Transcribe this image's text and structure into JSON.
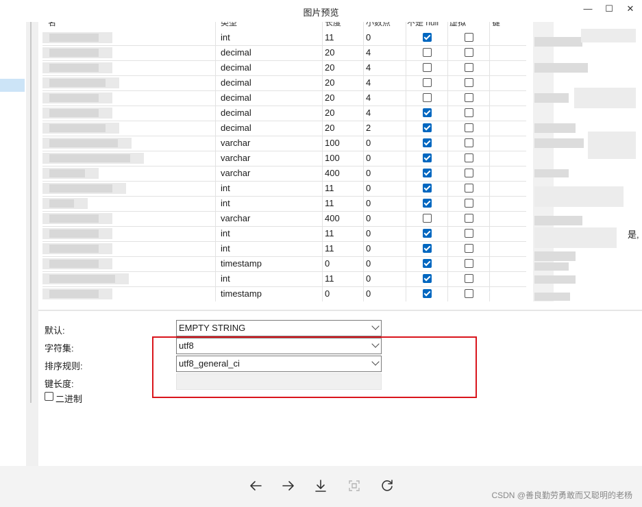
{
  "window": {
    "title": "图片预览",
    "controls": {
      "minimize": "—",
      "maximize": "☐",
      "close": "✕"
    }
  },
  "grid": {
    "columns": [
      "名",
      "类型",
      "长度",
      "小数点",
      "不是 null",
      "虚拟",
      "键"
    ],
    "rows": [
      {
        "type": "int",
        "length": "11",
        "decimals": "0",
        "not_null": true,
        "virtual": false
      },
      {
        "type": "decimal",
        "length": "20",
        "decimals": "4",
        "not_null": false,
        "virtual": false
      },
      {
        "type": "decimal",
        "length": "20",
        "decimals": "4",
        "not_null": false,
        "virtual": false
      },
      {
        "type": "decimal",
        "length": "20",
        "decimals": "4",
        "not_null": false,
        "virtual": false
      },
      {
        "type": "decimal",
        "length": "20",
        "decimals": "4",
        "not_null": false,
        "virtual": false
      },
      {
        "type": "decimal",
        "length": "20",
        "decimals": "4",
        "not_null": true,
        "virtual": false
      },
      {
        "type": "decimal",
        "length": "20",
        "decimals": "2",
        "not_null": true,
        "virtual": false
      },
      {
        "type": "varchar",
        "length": "100",
        "decimals": "0",
        "not_null": true,
        "virtual": false
      },
      {
        "type": "varchar",
        "length": "100",
        "decimals": "0",
        "not_null": true,
        "virtual": false
      },
      {
        "type": "varchar",
        "length": "400",
        "decimals": "0",
        "not_null": true,
        "virtual": false
      },
      {
        "type": "int",
        "length": "11",
        "decimals": "0",
        "not_null": true,
        "virtual": false
      },
      {
        "type": "int",
        "length": "11",
        "decimals": "0",
        "not_null": true,
        "virtual": false
      },
      {
        "type": "varchar",
        "length": "400",
        "decimals": "0",
        "not_null": false,
        "virtual": false
      },
      {
        "type": "int",
        "length": "11",
        "decimals": "0",
        "not_null": true,
        "virtual": false
      },
      {
        "type": "int",
        "length": "11",
        "decimals": "0",
        "not_null": true,
        "virtual": false
      },
      {
        "type": "timestamp",
        "length": "0",
        "decimals": "0",
        "not_null": true,
        "virtual": false
      },
      {
        "type": "int",
        "length": "11",
        "decimals": "0",
        "not_null": true,
        "virtual": false
      },
      {
        "type": "timestamp",
        "length": "0",
        "decimals": "0",
        "not_null": true,
        "virtual": false
      }
    ],
    "right_fragment": "是,"
  },
  "properties": {
    "default_label": "默认:",
    "default_value": "EMPTY STRING",
    "charset_label": "字符集:",
    "charset_value": "utf8",
    "collation_label": "排序规则:",
    "collation_value": "utf8_general_ci",
    "keylength_label": "键长度:",
    "binary_label": "二进制",
    "binary_checked": false
  },
  "toolbar": {
    "icons": [
      "arrow-left-icon",
      "arrow-right-icon",
      "download-icon",
      "fit-screen-icon",
      "rotate-icon"
    ]
  },
  "watermark": "CSDN @善良勤劳勇敢而又聪明的老杨",
  "colors": {
    "checkbox_checked": "#0067c0",
    "annotation": "#d9141b",
    "selection": "#cce4f7"
  }
}
